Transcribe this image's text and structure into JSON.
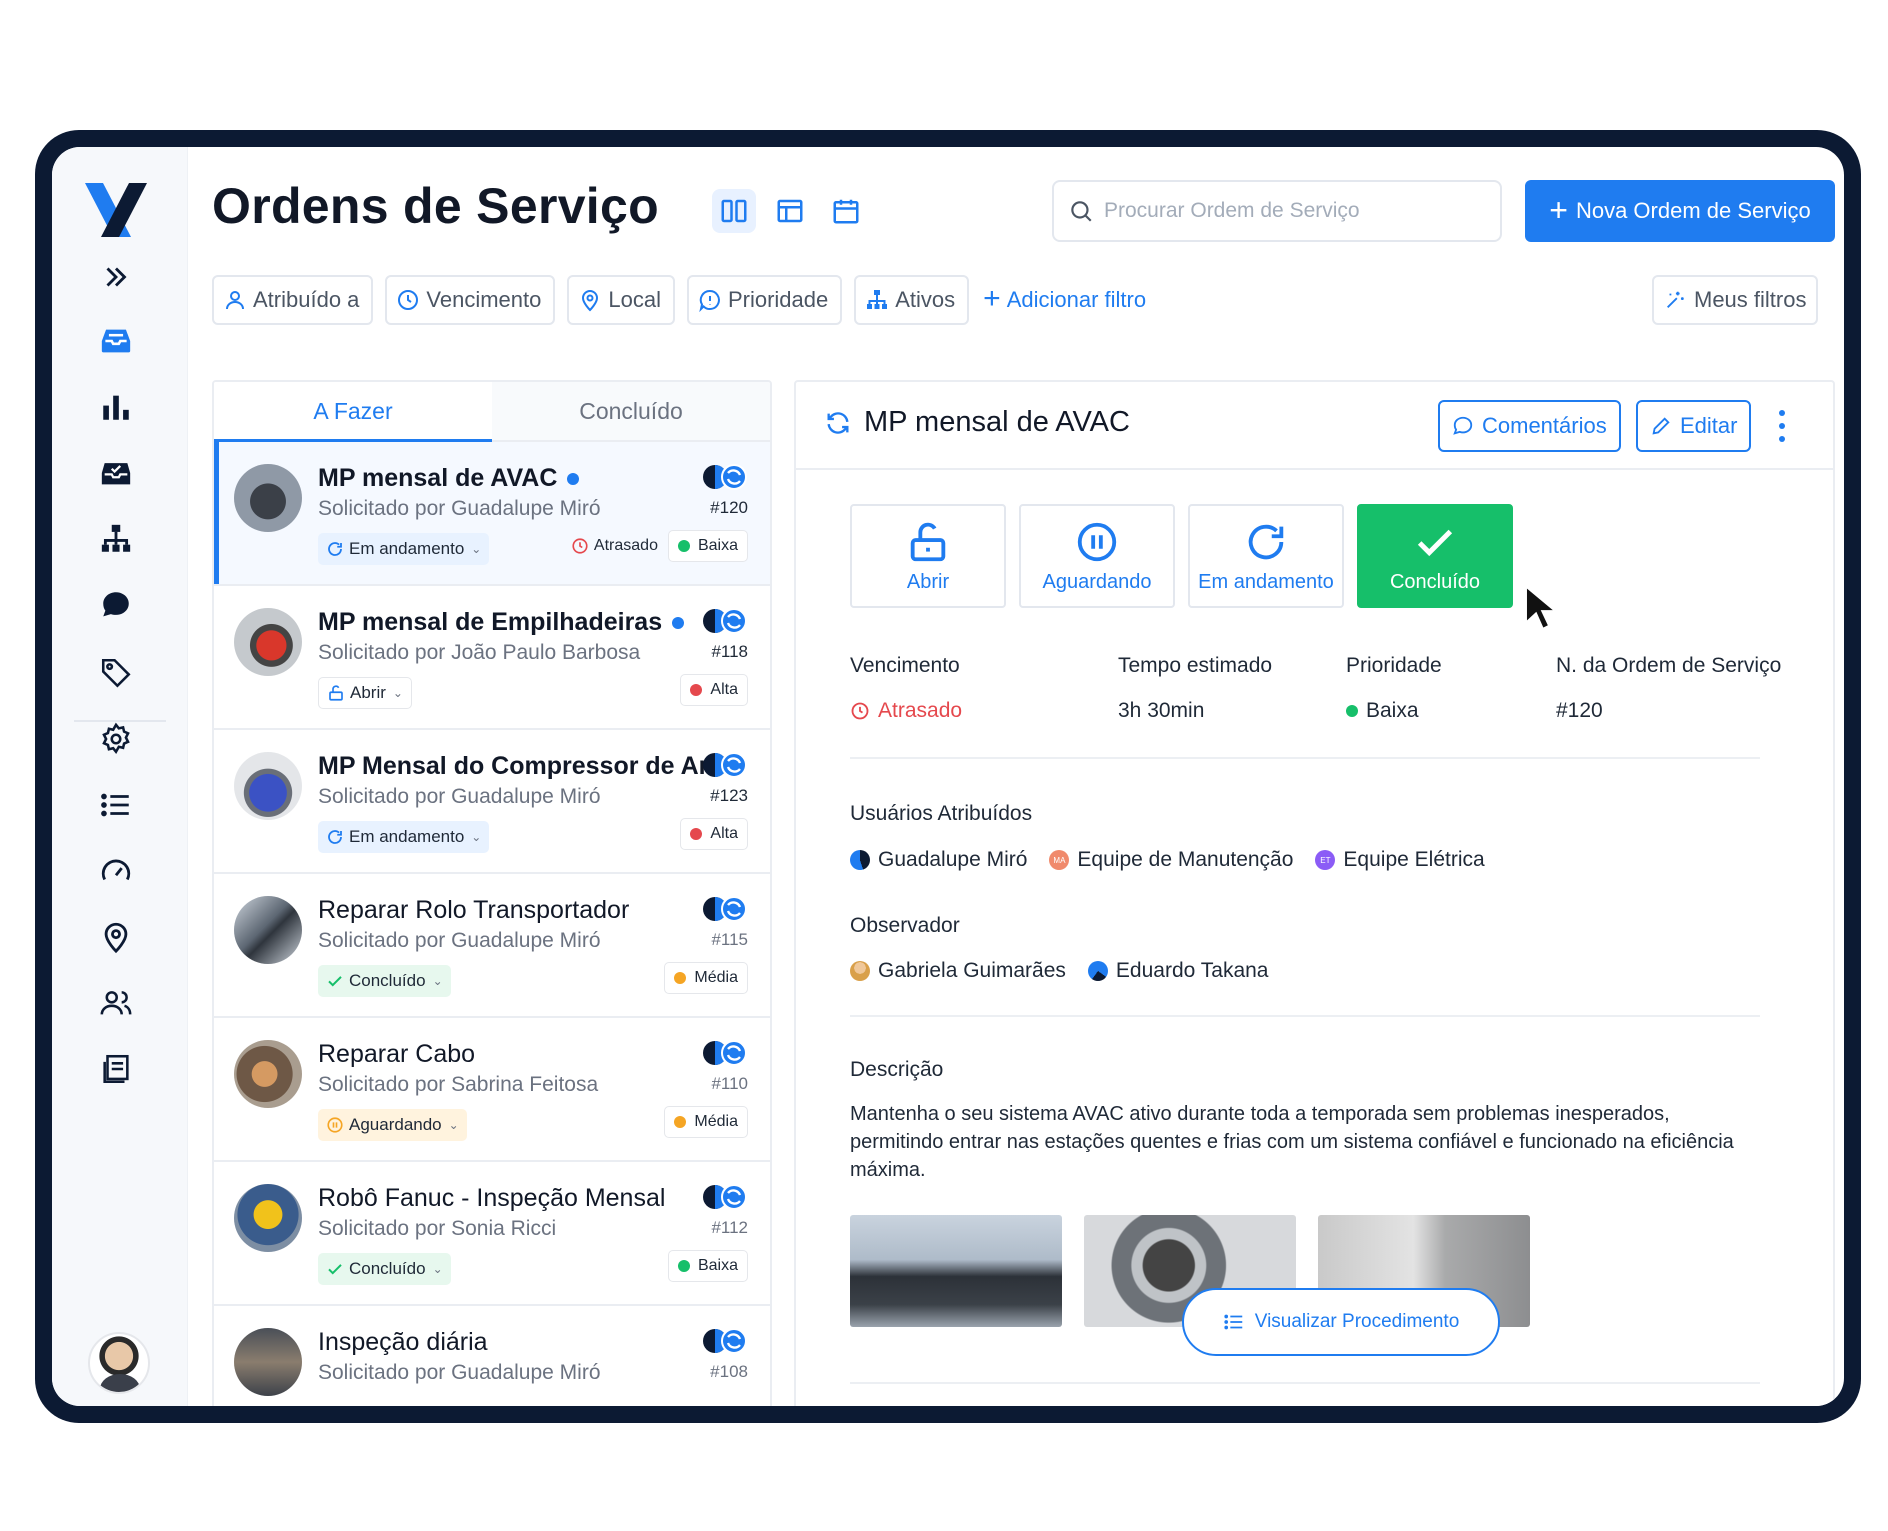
{
  "header": {
    "title": "Ordens de Serviço",
    "search_placeholder": "Procurar Ordem de Serviço",
    "new_button": "Nova Ordem de Serviço"
  },
  "filters": {
    "items": [
      "Atribuído a",
      "Vencimento",
      "Local",
      "Prioridade",
      "Ativos"
    ],
    "add": "Adicionar filtro",
    "my_filters": "Meus filtros"
  },
  "tabs": [
    "A Fazer",
    "Concluído"
  ],
  "work_orders": [
    {
      "title": "MP mensal de AVAC",
      "requested_by": "Solicitado por Guadalupe Miró",
      "number": "#120",
      "status": "Em andamento",
      "late": "Atrasado",
      "priority": "Baixa",
      "unread": true
    },
    {
      "title": "MP mensal de Empilhadeiras",
      "requested_by": "Solicitado por João Paulo Barbosa",
      "number": "#118",
      "status": "Abrir",
      "late": "",
      "priority": "Alta",
      "unread": true
    },
    {
      "title": "MP Mensal do Compressor de Ar",
      "requested_by": "Solicitado por Guadalupe Miró",
      "number": "#123",
      "status": "Em andamento",
      "late": "",
      "priority": "Alta",
      "unread": false
    },
    {
      "title": "Reparar Rolo Transportador",
      "requested_by": "Solicitado por Guadalupe Miró",
      "number": "#115",
      "status": "Concluído",
      "late": "",
      "priority": "Média",
      "unread": false
    },
    {
      "title": "Reparar Cabo",
      "requested_by": "Solicitado por Sabrina Feitosa",
      "number": "#110",
      "status": "Aguardando",
      "late": "",
      "priority": "Média",
      "unread": false
    },
    {
      "title": "Robô Fanuc - Inspeção Mensal",
      "requested_by": "Solicitado por Sonia Ricci",
      "number": "#112",
      "status": "Concluído",
      "late": "",
      "priority": "Baixa",
      "unread": false
    },
    {
      "title": "Inspeção diária",
      "requested_by": "Solicitado por Guadalupe Miró",
      "number": "#108",
      "status": "",
      "late": "",
      "priority": "",
      "unread": false
    }
  ],
  "detail": {
    "title": "MP mensal de AVAC",
    "comments_button": "Comentários",
    "edit_button": "Editar",
    "status_buttons": [
      "Abrir",
      "Aguardando",
      "Em andamento",
      "Concluído"
    ],
    "active_status": "Concluído",
    "meta": {
      "due_label": "Vencimento",
      "due_value": "Atrasado",
      "time_label": "Tempo estimado",
      "time_value": "3h 30min",
      "priority_label": "Prioridade",
      "priority_value": "Baixa",
      "number_label": "N. da Ordem de Serviço",
      "number_value": "#120"
    },
    "assigned_label": "Usuários Atribuídos",
    "assigned": [
      "Guadalupe Miró",
      "Equipe de Manutenção",
      "Equipe Elétrica"
    ],
    "assigned_initials": [
      "",
      "MA",
      "ET"
    ],
    "observer_label": "Observador",
    "observers": [
      "Gabriela Guimarães",
      "Eduardo Takana"
    ],
    "description_label": "Descrição",
    "description": "Mantenha o seu sistema AVAC ativo durante toda a temporada sem problemas inesperados, permitindo entrar nas estações quentes e frias com um sistema confiável e funcionado na eficiência máxima.",
    "view_procedure": "Visualizar Procedimento"
  },
  "colors": {
    "accent": "#1f7cf0",
    "done_green": "#16bf6a",
    "late_red": "#e5484d",
    "priority_low": "#16bf6a",
    "priority_high": "#e5484d",
    "priority_medium": "#f5a524"
  }
}
